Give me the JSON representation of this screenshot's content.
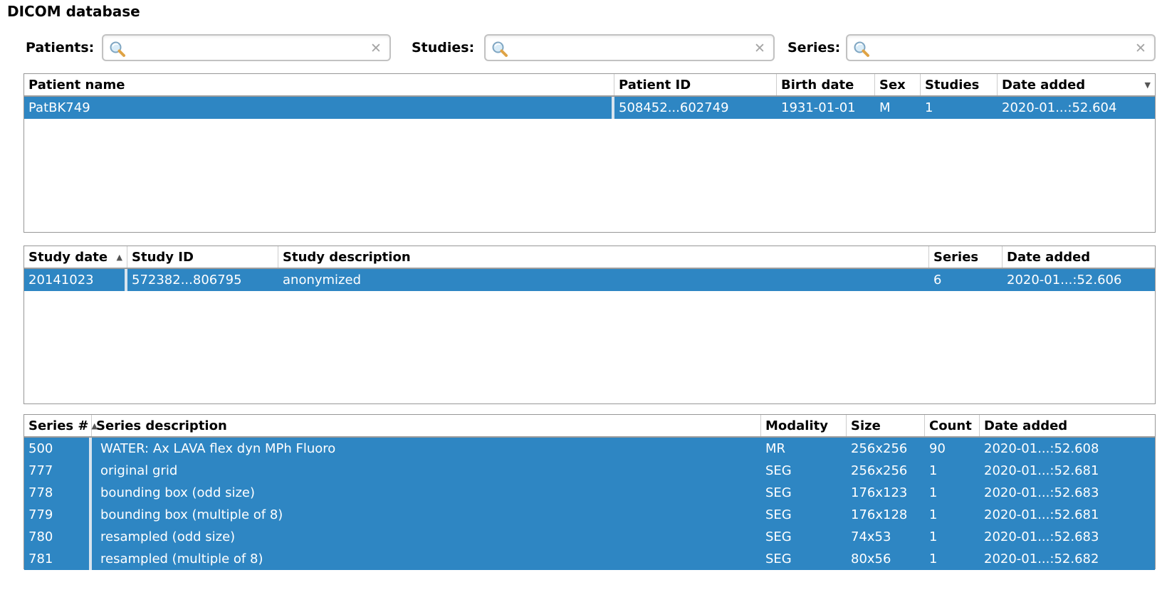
{
  "title": "DICOM database",
  "colors": {
    "selection_blue": "#2e86c3",
    "header_divider": "#cdcdcd",
    "table_border": "#979797"
  },
  "icons": {
    "search": "magnifier-icon",
    "clear": "✕",
    "sort_asc": "▲",
    "sort_desc": "▼"
  },
  "filters": {
    "patients": {
      "label": "Patients:",
      "value": "",
      "placeholder": ""
    },
    "studies": {
      "label": "Studies:",
      "value": "",
      "placeholder": ""
    },
    "series": {
      "label": "Series:",
      "value": "",
      "placeholder": ""
    }
  },
  "patients": {
    "columns": [
      "Patient name",
      "Patient ID",
      "Birth date",
      "Sex",
      "Studies",
      "Date added"
    ],
    "sort": {
      "column": "Date added",
      "direction": "descending"
    },
    "rows": [
      {
        "selected": true,
        "cells": [
          "PatBK749",
          "508452...602749",
          "1931-01-01",
          "M",
          "1",
          "2020-01...:52.604"
        ]
      }
    ]
  },
  "studies": {
    "columns": [
      "Study date",
      "Study ID",
      "Study description",
      "Series",
      "Date added"
    ],
    "sort": {
      "column": "Study date",
      "direction": "ascending"
    },
    "rows": [
      {
        "selected": true,
        "cells": [
          "20141023",
          "572382...806795",
          "anonymized",
          "6",
          "2020-01...:52.606"
        ]
      }
    ]
  },
  "series": {
    "columns": [
      "Series #",
      "Series description",
      "Modality",
      "Size",
      "Count",
      "Date added"
    ],
    "sort": {
      "column": "Series #",
      "direction": "ascending"
    },
    "rows": [
      {
        "selected": true,
        "cells": [
          "500",
          "WATER: Ax LAVA flex dyn MPh Fluoro",
          "MR",
          "256x256",
          "90",
          "2020-01...:52.608"
        ]
      },
      {
        "selected": true,
        "cells": [
          "777",
          "original grid",
          "SEG",
          "256x256",
          "1",
          "2020-01...:52.681"
        ]
      },
      {
        "selected": true,
        "cells": [
          "778",
          "bounding box (odd size)",
          "SEG",
          "176x123",
          "1",
          "2020-01...:52.683"
        ]
      },
      {
        "selected": true,
        "cells": [
          "779",
          "bounding box (multiple of 8)",
          "SEG",
          "176x128",
          "1",
          "2020-01...:52.681"
        ]
      },
      {
        "selected": true,
        "cells": [
          "780",
          "resampled (odd size)",
          "SEG",
          "74x53",
          "1",
          "2020-01...:52.683"
        ]
      },
      {
        "selected": true,
        "cells": [
          "781",
          "resampled (multiple of 8)",
          "SEG",
          "80x56",
          "1",
          "2020-01...:52.682"
        ]
      }
    ]
  }
}
